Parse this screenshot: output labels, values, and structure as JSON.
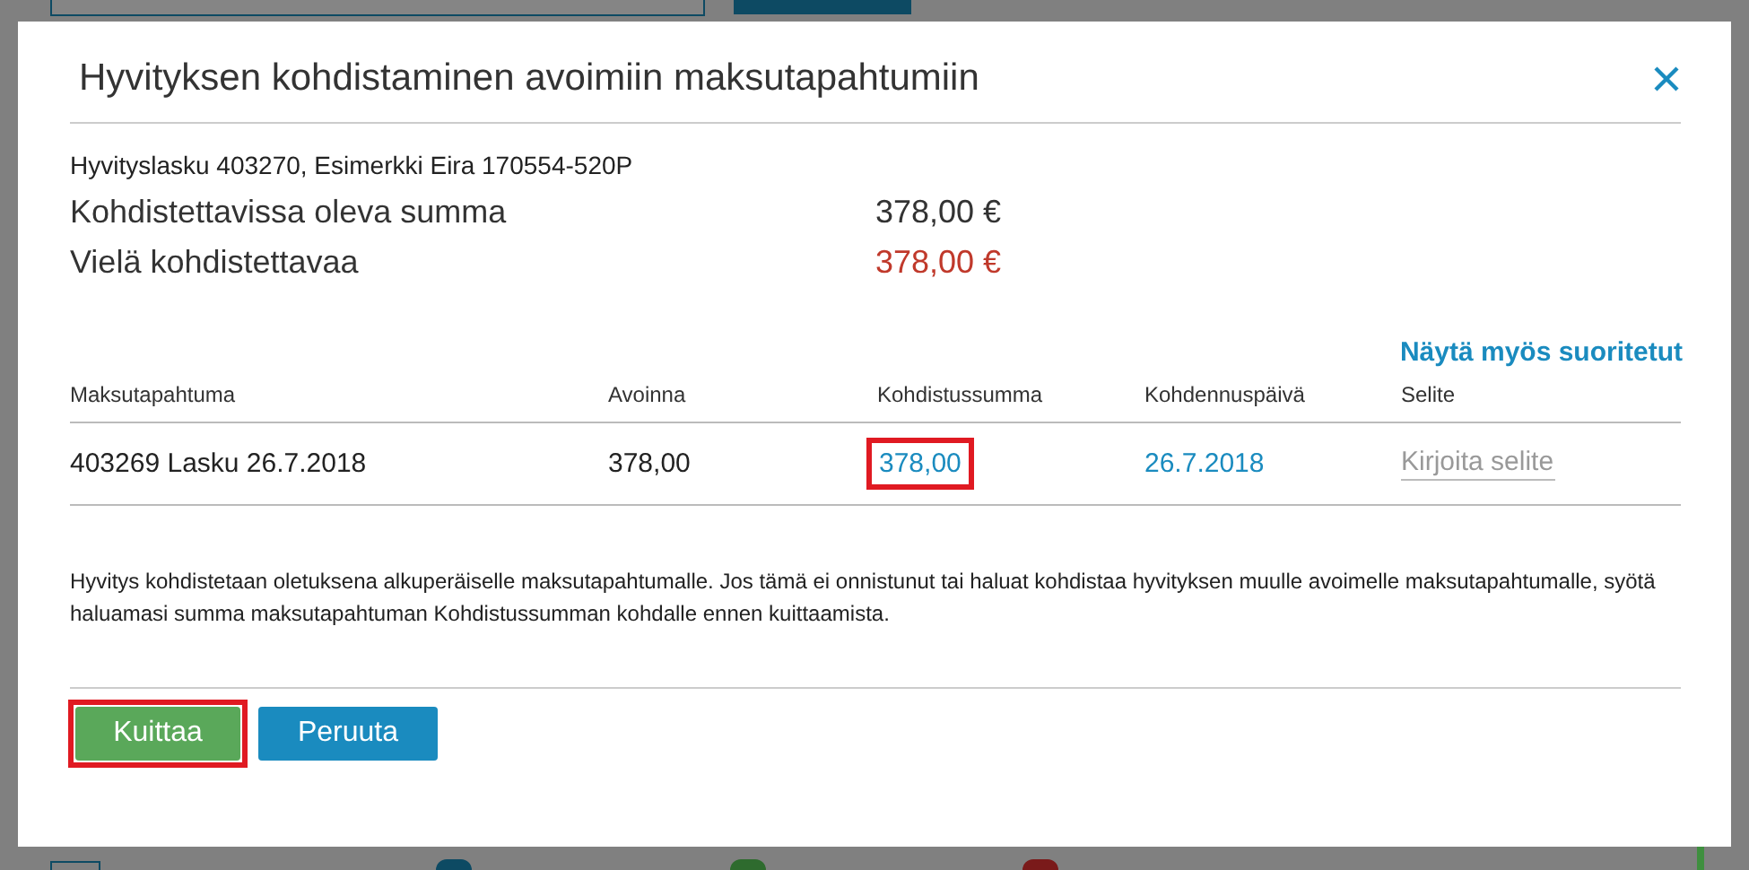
{
  "dialog": {
    "title": "Hyvityksen kohdistaminen avoimiin maksutapahtumiin",
    "invoice_line": "Hyvityslasku 403270, Esimerkki Eira 170554-520P",
    "summary": [
      {
        "label": "Kohdistettavissa oleva summa",
        "value": "378,00 €",
        "kind": "total"
      },
      {
        "label": "Vielä kohdistettavaa",
        "value": "378,00 €",
        "kind": "remaining"
      }
    ],
    "show_completed_link": "Näytä myös suoritetut",
    "table": {
      "columns": [
        "Maksutapahtuma",
        "Avoinna",
        "Kohdistussumma",
        "Kohdennuspäivä",
        "Selite"
      ],
      "rows": [
        {
          "payment": "403269 Lasku 26.7.2018",
          "open": "378,00",
          "amount": "378,00",
          "amount_highlighted": true,
          "date": "26.7.2018",
          "note_placeholder": "Kirjoita selite"
        }
      ]
    },
    "info": "Hyvitys kohdistetaan oletuksena alkuperäiselle maksutapahtumalle. Jos tämä ei onnistunut tai haluat kohdistaa hyvityksen muulle avoimelle maksutapahtumalle, syötä haluamasi summa maksutapahtuman Kohdistussumman kohdalle ennen kuittaamista.",
    "buttons": [
      {
        "label": "Kuittaa",
        "kind": "confirm",
        "highlighted": true
      },
      {
        "label": "Peruuta",
        "kind": "cancel",
        "highlighted": false
      }
    ]
  }
}
